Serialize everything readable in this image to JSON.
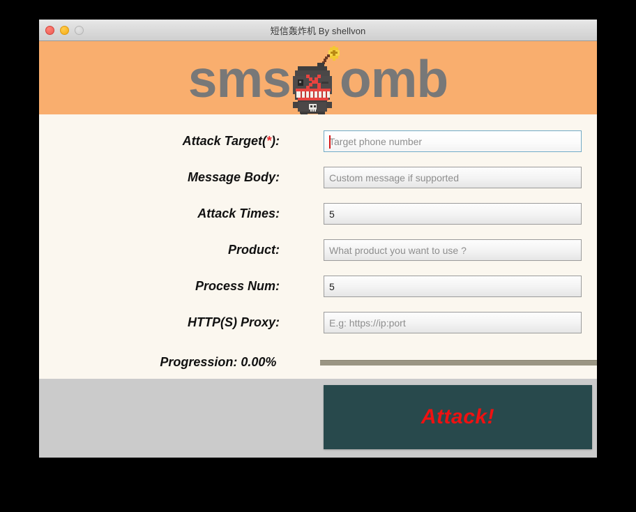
{
  "window": {
    "title": "短信轰炸机 By shellvon",
    "controls": {
      "close": "close-button",
      "minimize": "minimize-button",
      "zoom": "zoom-button"
    }
  },
  "header": {
    "logo_left": "sms",
    "logo_right": "omb",
    "mascot": "bomb-character",
    "background_color": "#F9AE6E",
    "logo_text_color": "#787878"
  },
  "form": {
    "rows": [
      {
        "label": "Attack Target(",
        "label_star": "*",
        "label_end": "):",
        "placeholder": "Target phone number",
        "value": "",
        "focused": true,
        "name": "attack-target"
      },
      {
        "label": "Message Body:",
        "placeholder": "Custom message if supported",
        "value": "",
        "focused": false,
        "name": "message-body"
      },
      {
        "label": "Attack Times:",
        "placeholder": "",
        "value": "5",
        "focused": false,
        "name": "attack-times"
      },
      {
        "label": "Product:",
        "placeholder": "What product you want to use ?",
        "value": "",
        "focused": false,
        "name": "product"
      },
      {
        "label": "Process Num:",
        "placeholder": "",
        "value": "5",
        "focused": false,
        "name": "process-num"
      },
      {
        "label": "HTTP(S) Proxy:",
        "placeholder": "E.g: https://ip:port",
        "value": "",
        "focused": false,
        "name": "http-proxy"
      }
    ],
    "progression": {
      "label": "Progression: 0.00%",
      "percent": 0
    }
  },
  "footer": {
    "attack_label": "Attack!",
    "attack_bg": "#28494C",
    "attack_text_color": "#EE1111",
    "panel_bg": "#CBCBCB"
  },
  "colors": {
    "body_bg": "#FBF7EF",
    "required_star": "#E8282B",
    "focus_border": "#6FA8C4",
    "caret": "#D41515"
  }
}
